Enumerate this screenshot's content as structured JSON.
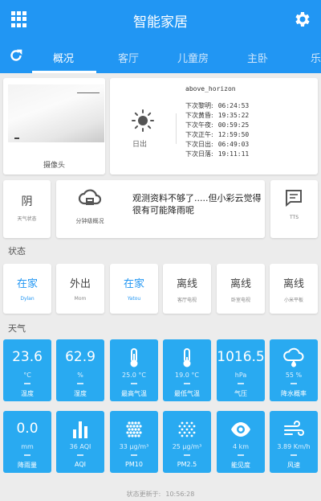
{
  "header": {
    "title": "智能家居"
  },
  "tabs": [
    {
      "label": "概况",
      "active": true
    },
    {
      "label": "客厅"
    },
    {
      "label": "儿童房"
    },
    {
      "label": "主卧"
    },
    {
      "label": "乐"
    }
  ],
  "camera": {
    "label": "摄像头"
  },
  "sun": {
    "entity": "above_horizon",
    "state": "日出",
    "rows": [
      {
        "label": "下次黎明:",
        "value": "06:24:53"
      },
      {
        "label": "下次黄昏:",
        "value": "19:35:22"
      },
      {
        "label": "下次午夜:",
        "value": "00:59:25"
      },
      {
        "label": "下次正午:",
        "value": "12:59:50"
      },
      {
        "label": "下次日出:",
        "value": "06:49:03"
      },
      {
        "label": "下次日落:",
        "value": "19:11:11"
      }
    ]
  },
  "weather_state": {
    "value": "阴",
    "label": "天气状态"
  },
  "minute_forecast": {
    "label": "分钟级概况",
    "text": "观测资料不够了.....但小彩云觉得很有可能降雨呢"
  },
  "tts": {
    "label": "TTS"
  },
  "status_section": {
    "title": "状态"
  },
  "people": [
    {
      "state": "在家",
      "name": "Dylan",
      "home": true
    },
    {
      "state": "外出",
      "name": "Mom",
      "home": false
    },
    {
      "state": "在家",
      "name": "Yatou",
      "home": true
    },
    {
      "state": "离线",
      "name": "客厅电视",
      "home": false
    },
    {
      "state": "离线",
      "name": "卧室电视",
      "home": false
    },
    {
      "state": "离线",
      "name": "小米平板",
      "home": false
    }
  ],
  "weather_section": {
    "title": "天气"
  },
  "weather_tiles": [
    {
      "value": "23.6",
      "unit": "°C",
      "label": "温度",
      "icon": ""
    },
    {
      "value": "62.9",
      "unit": "%",
      "label": "湿度",
      "icon": ""
    },
    {
      "value": "",
      "unit": "25.0 °C",
      "label": "最高气温",
      "icon": "thermometer-icon"
    },
    {
      "value": "",
      "unit": "19.0 °C",
      "label": "最低气温",
      "icon": "thermometer-icon"
    },
    {
      "value": "1016.5",
      "unit": "hPa",
      "label": "气压",
      "icon": ""
    },
    {
      "value": "",
      "unit": "55 %",
      "label": "降水概率",
      "icon": "rain-cloud-icon"
    },
    {
      "value": "0.0",
      "unit": "mm",
      "label": "降雨量",
      "icon": ""
    },
    {
      "value": "",
      "unit": "36 AQI",
      "label": "AQI",
      "icon": "bar-chart-icon"
    },
    {
      "value": "",
      "unit": "33 µg/m³",
      "label": "PM10",
      "icon": "dots-grid-icon"
    },
    {
      "value": "",
      "unit": "25 µg/m³",
      "label": "PM2.5",
      "icon": "dots-grid-icon"
    },
    {
      "value": "",
      "unit": "4 km",
      "label": "能见度",
      "icon": "eye-icon"
    },
    {
      "value": "",
      "unit": "3.89 Km/h",
      "label": "风速",
      "icon": "wind-icon"
    }
  ],
  "footer": {
    "label": "状态更新于:",
    "time": "10:56:28"
  },
  "colors": {
    "primary": "#2196f3",
    "tile": "#29aaf1",
    "background": "#ececec"
  }
}
